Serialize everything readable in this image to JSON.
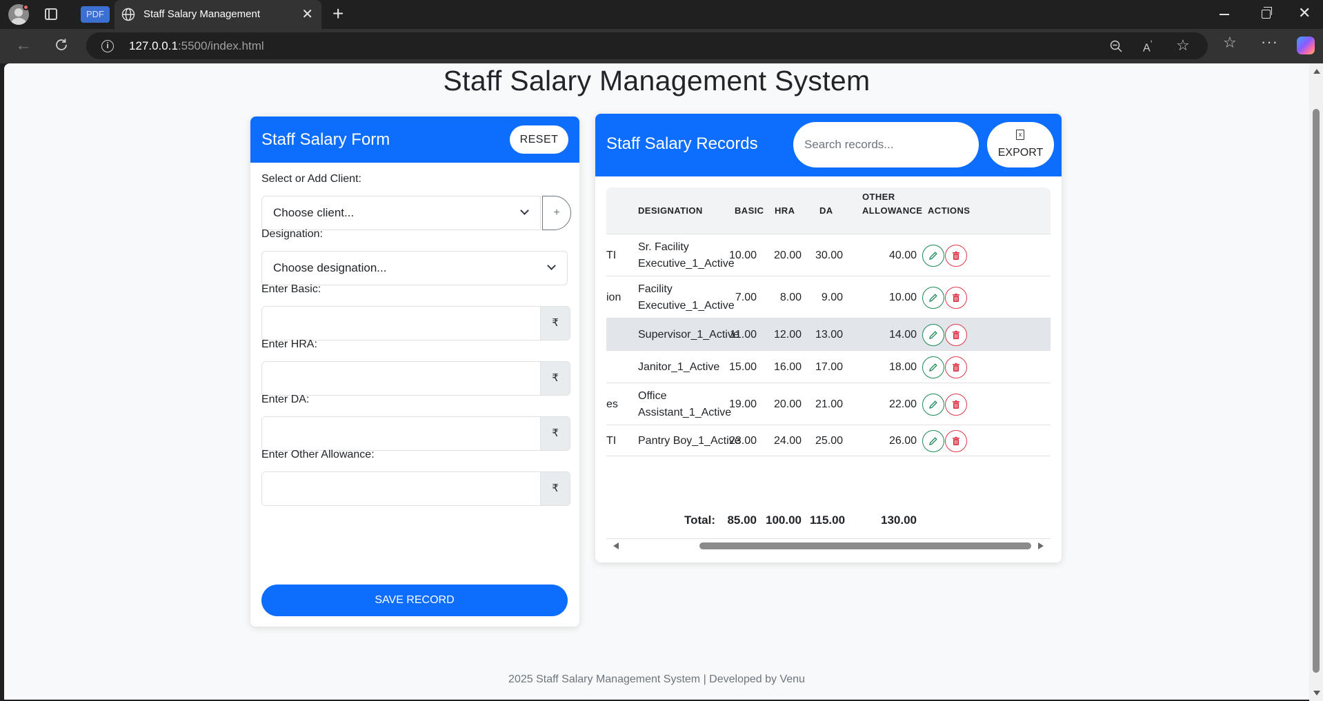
{
  "browser": {
    "pdf_badge": "PDF",
    "tab_title": "Staff Salary Management",
    "url_host": "127.0.0.1",
    "url_rest": ":5500/index.html"
  },
  "page": {
    "title": "Staff Salary Management System",
    "footer": "2025 Staff Salary Management System | Developed by Venu"
  },
  "form": {
    "title": "Staff Salary Form",
    "reset_label": "RESET",
    "client_label": "Select or Add Client:",
    "client_selected": "Choose client...",
    "add_client_symbol": "+",
    "designation_label": "Designation:",
    "designation_selected": "Choose designation...",
    "basic_label": "Enter Basic:",
    "hra_label": "Enter HRA:",
    "da_label": "Enter DA:",
    "other_label": "Enter Other Allowance:",
    "currency_symbol": "₹",
    "save_label": "SAVE RECORD"
  },
  "records": {
    "title": "Staff Salary Records",
    "search_placeholder": "Search records...",
    "export_label": "EXPORT",
    "export_icon_glyph": "x",
    "columns": {
      "designation": "DESIGNATION",
      "basic": "BASIC",
      "hra": "HRA",
      "da": "DA",
      "other_line1": "OTHER",
      "other_line2": "ALLOWANCE",
      "actions": "ACTIONS"
    },
    "rows": [
      {
        "clipped": "TI",
        "designation_1": "Sr. Facility",
        "designation_2": "Executive_1_Active",
        "basic": "10.00",
        "hra": "20.00",
        "da": "30.00",
        "other": "40.00"
      },
      {
        "clipped": "ion",
        "designation_1": "Facility",
        "designation_2": "Executive_1_Active",
        "basic": "7.00",
        "hra": "8.00",
        "da": "9.00",
        "other": "10.00"
      },
      {
        "clipped": "",
        "designation_1": "Supervisor_1_Active",
        "designation_2": "",
        "basic": "11.00",
        "hra": "12.00",
        "da": "13.00",
        "other": "14.00"
      },
      {
        "clipped": "",
        "designation_1": "Janitor_1_Active",
        "designation_2": "",
        "basic": "15.00",
        "hra": "16.00",
        "da": "17.00",
        "other": "18.00"
      },
      {
        "clipped": "es",
        "designation_1": "Office",
        "designation_2": "Assistant_1_Active",
        "basic": "19.00",
        "hra": "20.00",
        "da": "21.00",
        "other": "22.00"
      },
      {
        "clipped": "TI",
        "designation_1": "Pantry Boy_1_Active",
        "designation_2": "",
        "basic": "23.00",
        "hra": "24.00",
        "da": "25.00",
        "other": "26.00"
      }
    ],
    "totals": {
      "label": "Total:",
      "basic": "85.00",
      "hra": "100.00",
      "da": "115.00",
      "other": "130.00"
    },
    "highlighted_row": 3
  },
  "colors": {
    "primary": "#0d6efd",
    "edit": "#198754",
    "delete": "#dc3545"
  },
  "icons": [
    "profile-icon",
    "tabs-icon",
    "globe-icon",
    "close-icon",
    "plus-icon",
    "back-icon",
    "reload-icon",
    "info-icon",
    "zoom-icon",
    "read-aloud-icon",
    "star-icon",
    "favorites-icon",
    "more-icon",
    "copilot-icon",
    "chevron-down-icon",
    "rupee-icon",
    "excel-icon",
    "edit-icon",
    "trash-icon"
  ]
}
